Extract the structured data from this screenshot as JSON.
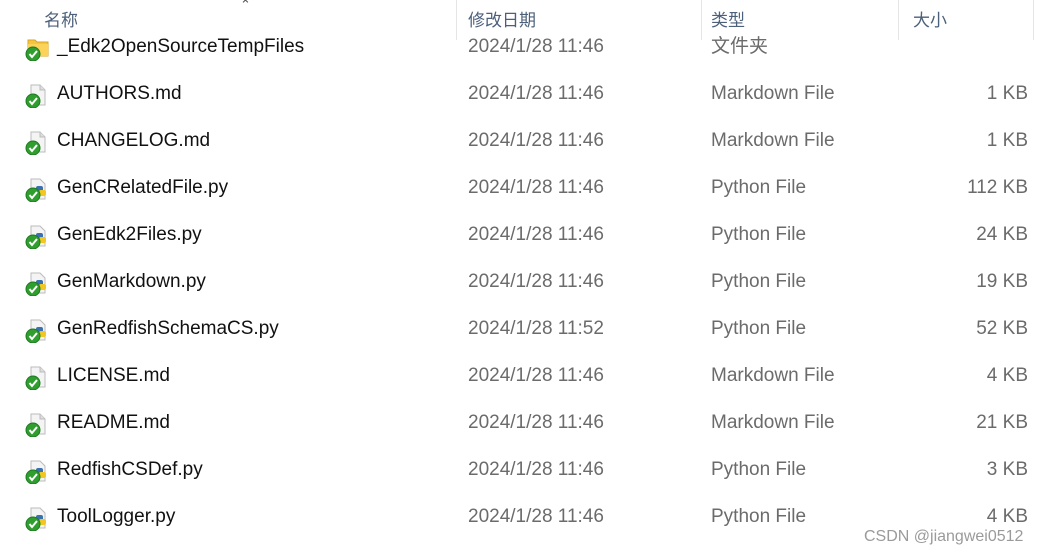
{
  "header": {
    "name": "名称",
    "date": "修改日期",
    "type": "类型",
    "size": "大小",
    "sort_indicator": "chevron-up-icon"
  },
  "rows": [
    {
      "name": "_Edk2OpenSourceTempFiles",
      "date": "2024/1/28 11:46",
      "type": "文件夹",
      "size": "",
      "icon": "folder"
    },
    {
      "name": "AUTHORS.md",
      "date": "2024/1/28 11:46",
      "type": "Markdown File",
      "size": "1 KB",
      "icon": "file"
    },
    {
      "name": "CHANGELOG.md",
      "date": "2024/1/28 11:46",
      "type": "Markdown File",
      "size": "1 KB",
      "icon": "file"
    },
    {
      "name": "GenCRelatedFile.py",
      "date": "2024/1/28 11:46",
      "type": "Python File",
      "size": "112 KB",
      "icon": "python"
    },
    {
      "name": "GenEdk2Files.py",
      "date": "2024/1/28 11:46",
      "type": "Python File",
      "size": "24 KB",
      "icon": "python"
    },
    {
      "name": "GenMarkdown.py",
      "date": "2024/1/28 11:46",
      "type": "Python File",
      "size": "19 KB",
      "icon": "python"
    },
    {
      "name": "GenRedfishSchemaCS.py",
      "date": "2024/1/28 11:52",
      "type": "Python File",
      "size": "52 KB",
      "icon": "python"
    },
    {
      "name": "LICENSE.md",
      "date": "2024/1/28 11:46",
      "type": "Markdown File",
      "size": "4 KB",
      "icon": "file"
    },
    {
      "name": "README.md",
      "date": "2024/1/28 11:46",
      "type": "Markdown File",
      "size": "21 KB",
      "icon": "file"
    },
    {
      "name": "RedfishCSDef.py",
      "date": "2024/1/28 11:46",
      "type": "Python File",
      "size": "3 KB",
      "icon": "python"
    },
    {
      "name": "ToolLogger.py",
      "date": "2024/1/28 11:46",
      "type": "Python File",
      "size": "4 KB",
      "icon": "python"
    }
  ],
  "watermark": "CSDN @jiangwei0512"
}
